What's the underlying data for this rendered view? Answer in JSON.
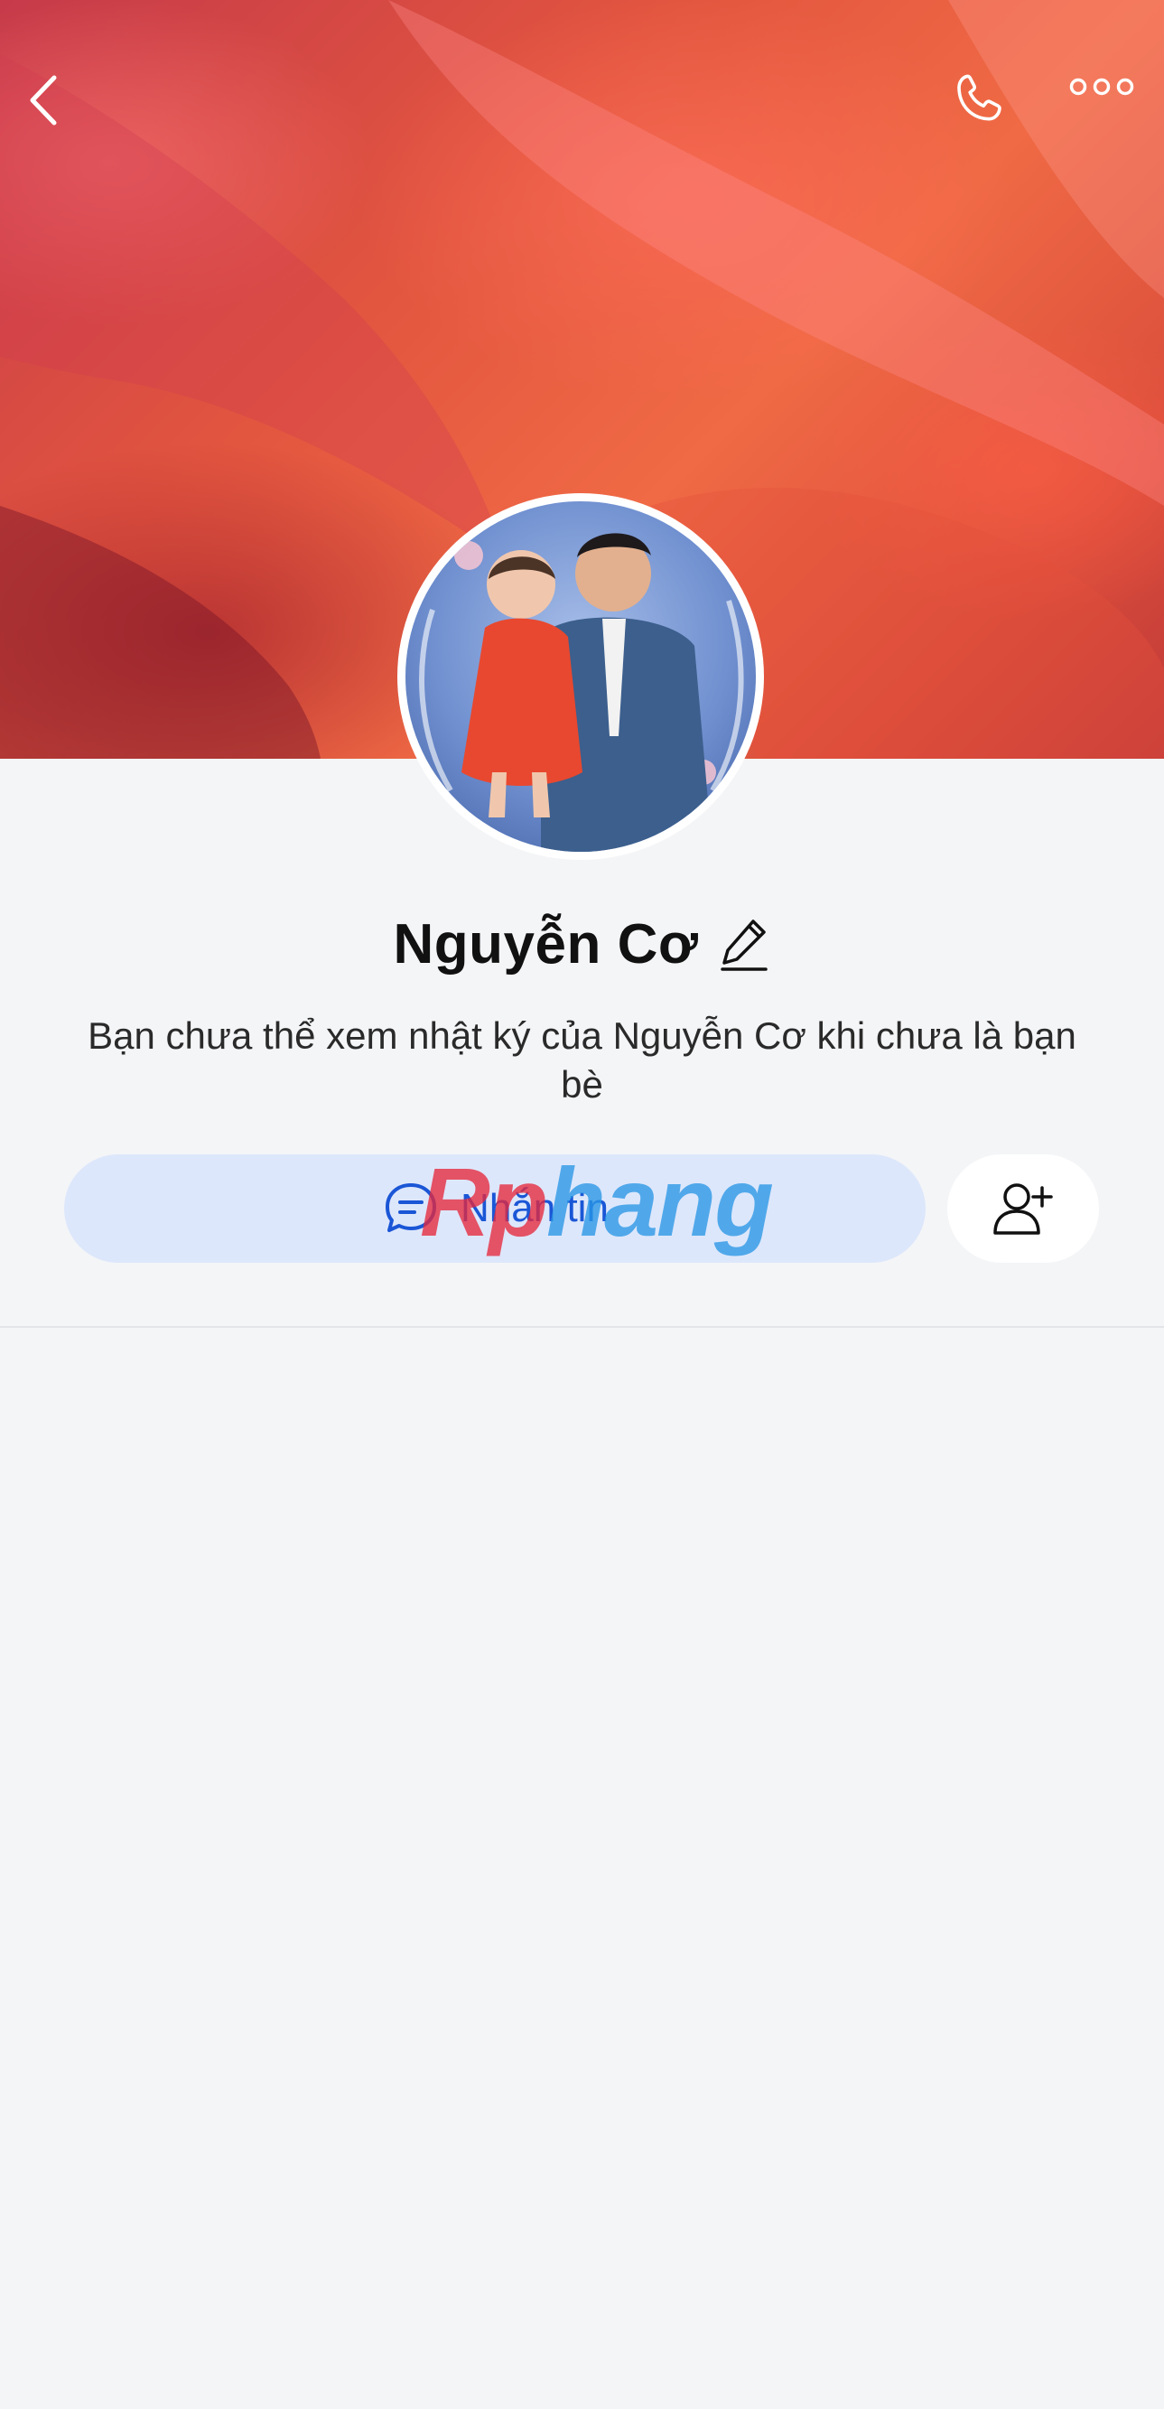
{
  "profile": {
    "name": "Nguyễn Cơ",
    "notice": "Bạn chưa thể xem nhật ký của Nguyễn Cơ khi chưa là bạn bè"
  },
  "actions": {
    "message_label": "Nhắn tin"
  },
  "watermark": {
    "part1": "Rp",
    "part2": "hang"
  },
  "icons": {
    "back": "chevron-left-icon",
    "call": "phone-icon",
    "more": "more-horizontal-icon",
    "edit": "pencil-icon",
    "message": "chat-bubble-icon",
    "add_friend": "add-user-icon"
  },
  "colors": {
    "accent": "#1a56d6",
    "message_button_bg": "#dde7fb",
    "background": "#f4f5f7"
  }
}
